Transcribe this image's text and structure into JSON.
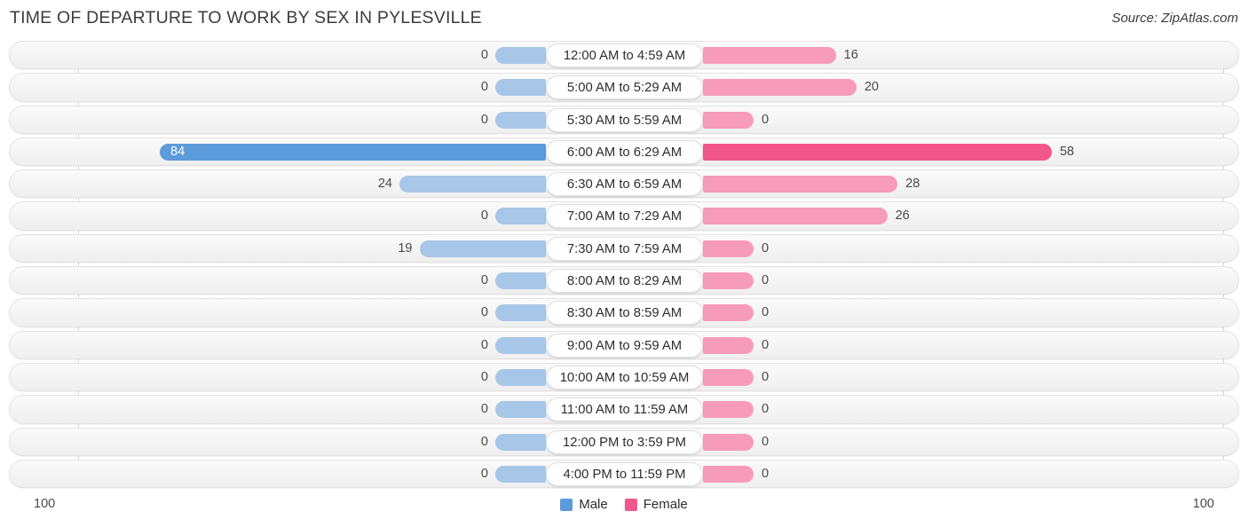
{
  "header": {
    "title": "TIME OF DEPARTURE TO WORK BY SEX IN PYLESVILLE",
    "source": "Source: ZipAtlas.com"
  },
  "footer": {
    "axis_left": "100",
    "axis_right": "100",
    "legend": [
      {
        "label": "Male",
        "color": "#5b9bdb"
      },
      {
        "label": "Female",
        "color": "#f2568b"
      }
    ]
  },
  "colors": {
    "male_light": "#a8c6e8",
    "male_dark": "#5b9bdb",
    "female_light": "#f79bba",
    "female_dark": "#f2568b",
    "track": "#f4f4f4",
    "gridline": "#d8d8d8",
    "text": "#3c3c3c"
  },
  "chart_data": {
    "type": "bar",
    "orientation": "horizontal",
    "style": "diverging-bidirectional",
    "title": "TIME OF DEPARTURE TO WORK BY SEX IN PYLESVILLE",
    "xlabel": "",
    "ylabel": "",
    "xlim": [
      100,
      100
    ],
    "axis_left_max": 100,
    "axis_right_max": 100,
    "grid": true,
    "legend_position": "bottom-center",
    "categories": [
      "12:00 AM to 4:59 AM",
      "5:00 AM to 5:29 AM",
      "5:30 AM to 5:59 AM",
      "6:00 AM to 6:29 AM",
      "6:30 AM to 6:59 AM",
      "7:00 AM to 7:29 AM",
      "7:30 AM to 7:59 AM",
      "8:00 AM to 8:29 AM",
      "8:30 AM to 8:59 AM",
      "9:00 AM to 9:59 AM",
      "10:00 AM to 10:59 AM",
      "11:00 AM to 11:59 AM",
      "12:00 PM to 3:59 PM",
      "4:00 PM to 11:59 PM"
    ],
    "series": [
      {
        "name": "Male",
        "side": "left",
        "values": [
          0,
          0,
          0,
          84,
          24,
          0,
          19,
          0,
          0,
          0,
          0,
          0,
          0,
          0
        ]
      },
      {
        "name": "Female",
        "side": "right",
        "values": [
          16,
          20,
          0,
          58,
          28,
          26,
          0,
          0,
          0,
          0,
          0,
          0,
          0,
          0
        ]
      }
    ],
    "highlighted_row_index": 3,
    "rows": [
      {
        "category": "12:00 AM to 4:59 AM",
        "male": 0,
        "female": 16,
        "highlight": false
      },
      {
        "category": "5:00 AM to 5:29 AM",
        "male": 0,
        "female": 20,
        "highlight": false
      },
      {
        "category": "5:30 AM to 5:59 AM",
        "male": 0,
        "female": 0,
        "highlight": false
      },
      {
        "category": "6:00 AM to 6:29 AM",
        "male": 84,
        "female": 58,
        "highlight": true
      },
      {
        "category": "6:30 AM to 6:59 AM",
        "male": 24,
        "female": 28,
        "highlight": false
      },
      {
        "category": "7:00 AM to 7:29 AM",
        "male": 0,
        "female": 26,
        "highlight": false
      },
      {
        "category": "7:30 AM to 7:59 AM",
        "male": 19,
        "female": 0,
        "highlight": false
      },
      {
        "category": "8:00 AM to 8:29 AM",
        "male": 0,
        "female": 0,
        "highlight": false
      },
      {
        "category": "8:30 AM to 8:59 AM",
        "male": 0,
        "female": 0,
        "highlight": false
      },
      {
        "category": "9:00 AM to 9:59 AM",
        "male": 0,
        "female": 0,
        "highlight": false
      },
      {
        "category": "10:00 AM to 10:59 AM",
        "male": 0,
        "female": 0,
        "highlight": false
      },
      {
        "category": "11:00 AM to 11:59 AM",
        "male": 0,
        "female": 0,
        "highlight": false
      },
      {
        "category": "12:00 PM to 3:59 PM",
        "male": 0,
        "female": 0,
        "highlight": false
      },
      {
        "category": "4:00 PM to 11:59 PM",
        "male": 0,
        "female": 0,
        "highlight": false
      }
    ]
  }
}
